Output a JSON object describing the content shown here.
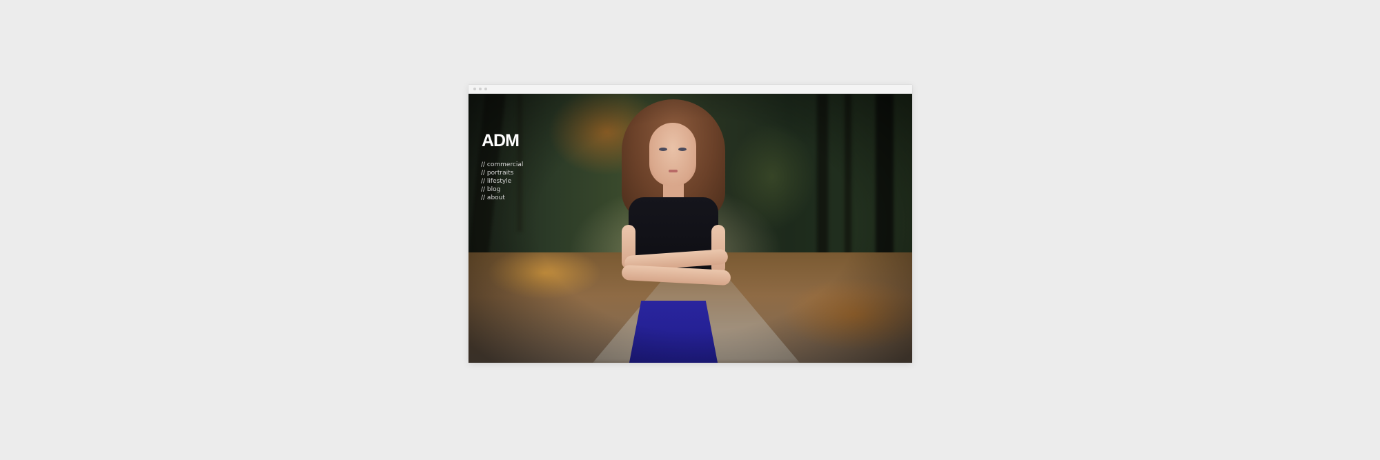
{
  "site": {
    "logo": "ADM",
    "nav": [
      {
        "label": "// commercial"
      },
      {
        "label": "// portraits"
      },
      {
        "label": "// lifestyle"
      },
      {
        "label": "// blog"
      },
      {
        "label": "// about"
      }
    ]
  },
  "colors": {
    "page_background": "#ececec",
    "logo_color": "#ffffff",
    "nav_text": "#d8d8d8"
  }
}
